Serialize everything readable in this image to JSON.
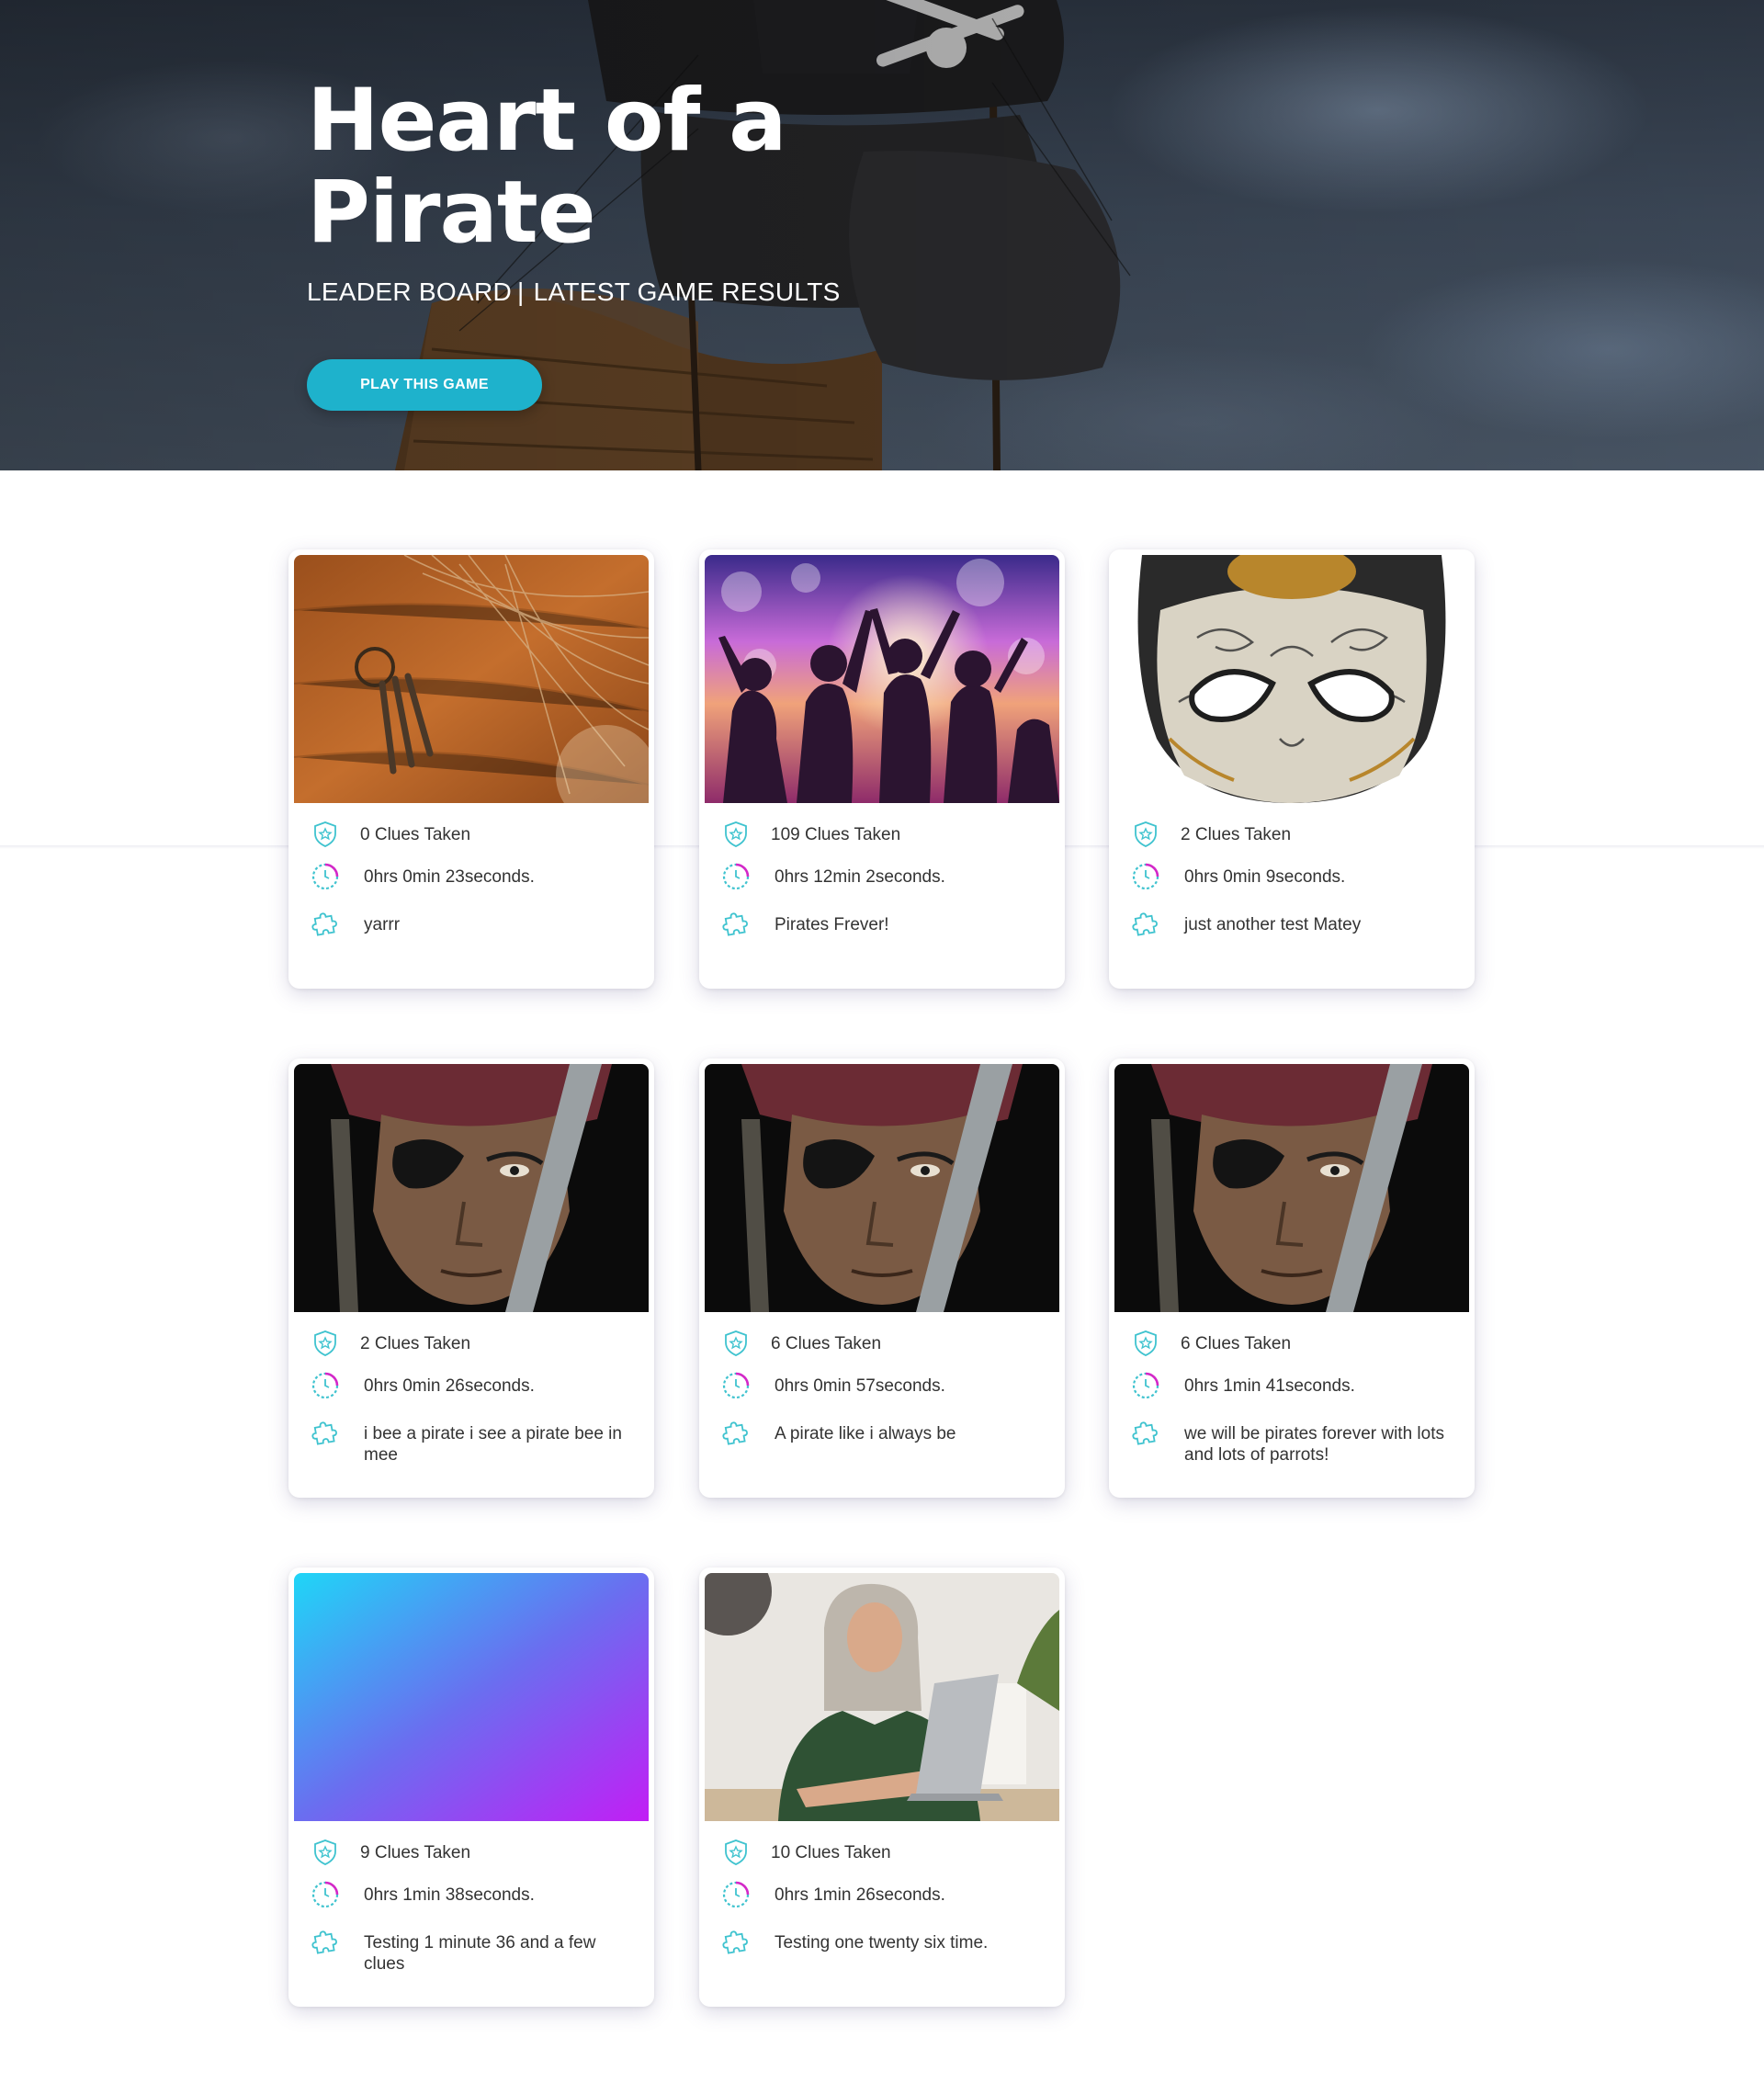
{
  "hero": {
    "title": "Heart of a Pirate",
    "subtitle_left": "LEADER BOARD",
    "subtitle_sep": "|",
    "subtitle_right": "LATEST GAME RESULTS",
    "play_button": "PLAY THIS GAME"
  },
  "colors": {
    "accent": "#1eb2cc",
    "icon_teal": "#3fc3cf",
    "icon_magenta": "#d428c8"
  },
  "icons": {
    "clues": "shield-star-icon",
    "time": "timer-icon",
    "message": "puzzle-piece-icon",
    "background": "pirate-ship-icon"
  },
  "results": [
    {
      "image": "keys-on-net-photo",
      "clues": "0 Clues Taken",
      "time": "0hrs 0min 23seconds.",
      "message": "yarrr"
    },
    {
      "image": "crowd-celebrating-photo",
      "clues": "109 Clues Taken",
      "time": "0hrs 12min 2seconds.",
      "message": "Pirates Frever!"
    },
    {
      "image": "venetian-mask-photo",
      "clues": "2 Clues Taken",
      "time": "0hrs 0min 9seconds.",
      "message": "just another test Matey"
    },
    {
      "image": "pirate-eyepatch-photo",
      "clues": "2 Clues Taken",
      "time": "0hrs 0min 26seconds.",
      "message": "i bee a pirate i see a pirate bee in mee"
    },
    {
      "image": "pirate-eyepatch-photo",
      "clues": "6 Clues Taken",
      "time": "0hrs 0min 57seconds.",
      "message": "A pirate like i always be"
    },
    {
      "image": "pirate-eyepatch-photo",
      "clues": "6 Clues Taken",
      "time": "0hrs 1min 41seconds.",
      "message": "we will be pirates forever with lots and lots of parrots!"
    },
    {
      "image": "blue-purple-gradient",
      "clues": "9 Clues Taken",
      "time": "0hrs 1min 38seconds.",
      "message": "Testing 1 minute 36 and a few clues"
    },
    {
      "image": "woman-laptop-photo",
      "clues": "10 Clues Taken",
      "time": "0hrs 1min 26seconds.",
      "message": "Testing one twenty six time."
    }
  ]
}
